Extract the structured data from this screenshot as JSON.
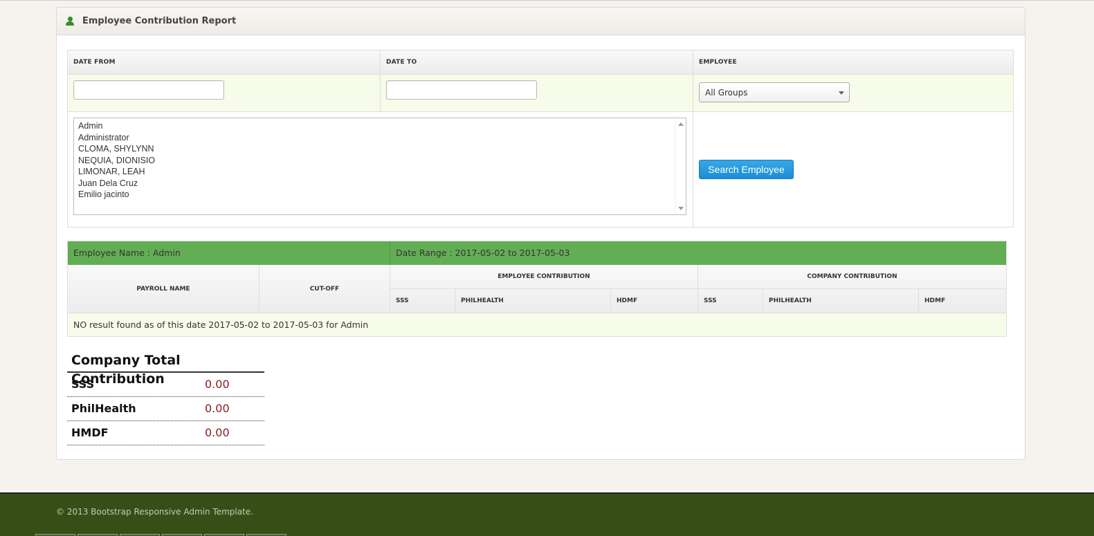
{
  "widget": {
    "title": "Employee Contribution Report",
    "icon": "user-icon"
  },
  "filters": {
    "date_from_label": "DATE FROM",
    "date_to_label": "DATE TO",
    "employee_label": "EMPLOYEE",
    "date_from_value": "",
    "date_to_value": "",
    "group_selected": "All Groups",
    "employees": [
      "Admin",
      "Administrator",
      "CLOMA, SHYLYNN",
      "NEQUIA, DIONISIO",
      "LIMONAR, LEAH",
      "Juan Dela Cruz",
      "Emilio jacinto"
    ],
    "search_button": "Search Employee"
  },
  "results": {
    "employee_name": "Employee Name : Admin",
    "date_range": "Date Range : 2017-05-02 to 2017-05-03",
    "headers": {
      "payroll_name": "PAYROLL NAME",
      "cutoff": "CUT-OFF",
      "employee_contribution": "EMPLOYEE CONTRIBUTION",
      "company_contribution": "COMPANY CONTRIBUTION",
      "sss": "SSS",
      "philhealth": "PHILHEALTH",
      "hdmf": "HDMF"
    },
    "empty_message": "NO result found as of this date 2017-05-02 to 2017-05-03 for Admin"
  },
  "totals": {
    "title": "Company Total Contribution",
    "rows": [
      {
        "label": "SSS",
        "value": "0.00"
      },
      {
        "label": "PhilHealth",
        "value": "0.00"
      },
      {
        "label": "HMDF",
        "value": "0.00"
      }
    ]
  },
  "footer": {
    "copyright": "© 2013 Bootstrap Responsive Admin Template."
  },
  "colors": {
    "green_header": "#63ae55",
    "footer_bg": "#374f16",
    "button_blue": "#1b8ed6",
    "value_red": "#8b1a1a"
  }
}
